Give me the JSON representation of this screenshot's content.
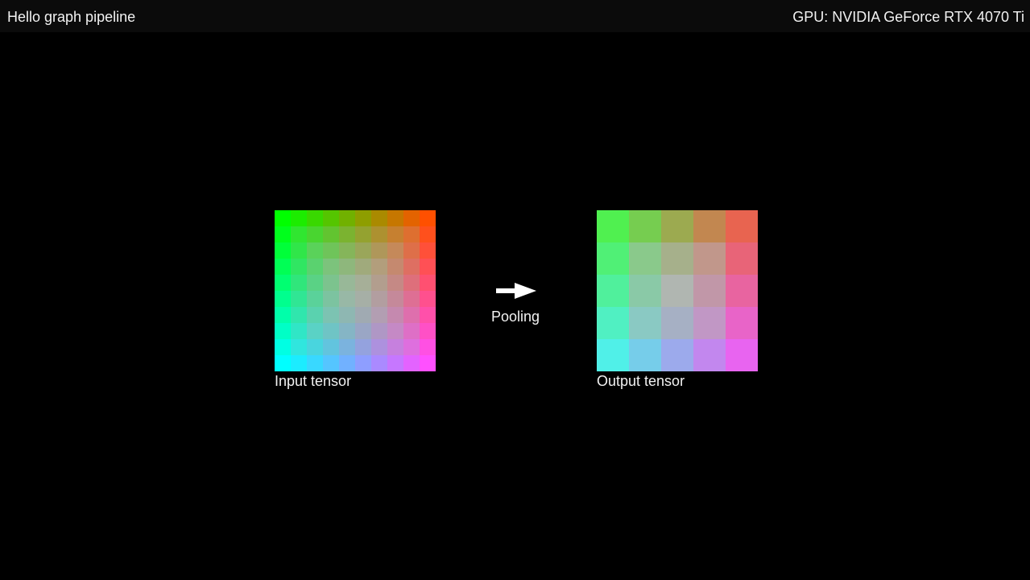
{
  "window": {
    "title": "Hello graph pipeline",
    "gpu_label": "GPU: NVIDIA GeForce RTX 4070 Ti"
  },
  "pipeline": {
    "input_caption": "Input tensor",
    "output_caption": "Output tensor",
    "operation_label": "Pooling",
    "input_grid": {
      "rows": 10,
      "cols": 10,
      "top_left": "#00ff00",
      "top_right": "#ff5000",
      "bottom_left": "#00ffff",
      "bottom_right": "#ff50ff",
      "center_gray": "#c0c0c0"
    },
    "output_grid": {
      "rows": 5,
      "cols": 5,
      "top_left": "#50f050",
      "top_right": "#e86450",
      "bottom_left": "#50f0e8",
      "bottom_right": "#e864f0",
      "center_gray": "#c0c0c0"
    }
  },
  "icons": {
    "arrow": "arrow-right-icon"
  }
}
